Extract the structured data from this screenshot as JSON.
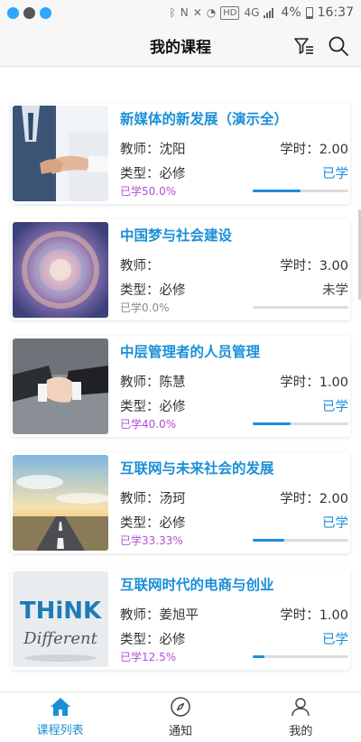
{
  "status_bar": {
    "time": "16:37",
    "battery": "4%",
    "hd": "HD",
    "network": "4G"
  },
  "header": {
    "title": "我的课程"
  },
  "courses": [
    {
      "title": "新媒体的新发展（演示全）",
      "teacher": "教师：沈阳",
      "hours": "学时：2.00",
      "type": "类型：必修",
      "status": "已学",
      "progress_text": "已学50.0%",
      "progress": 0.5,
      "image": "handshake-business"
    },
    {
      "title": "中国梦与社会建设",
      "teacher": "教师：",
      "hours": "学时：3.00",
      "type": "类型：必修",
      "status": "未学",
      "progress_text": "已学0.0%",
      "progress": 0.0,
      "image": "abstract-swirl"
    },
    {
      "title": "中层管理者的人员管理",
      "teacher": "教师：陈慧",
      "hours": "学时：1.00",
      "type": "类型：必修",
      "status": "已学",
      "progress_text": "已学40.0%",
      "progress": 0.4,
      "image": "handshake-closeup"
    },
    {
      "title": "互联网与未来社会的发展",
      "teacher": "教师：汤珂",
      "hours": "学时：2.00",
      "type": "类型：必修",
      "status": "已学",
      "progress_text": "已学33.33%",
      "progress": 0.3333,
      "image": "road-sunset"
    },
    {
      "title": "互联网时代的电商与创业",
      "teacher": "教师：姜旭平",
      "hours": "学时：1.00",
      "type": "类型：必修",
      "status": "已学",
      "progress_text": "已学12.5%",
      "progress": 0.125,
      "image": "think-different",
      "image_text": [
        "THiNK",
        "Different"
      ]
    }
  ],
  "tabs": [
    {
      "label": "课程列表",
      "icon": "home-icon",
      "active": true
    },
    {
      "label": "通知",
      "icon": "compass-icon",
      "active": false
    },
    {
      "label": "我的",
      "icon": "user-icon",
      "active": false
    }
  ],
  "colors": {
    "accent": "#1a8fd8",
    "progress_text": "#b24fd6"
  }
}
